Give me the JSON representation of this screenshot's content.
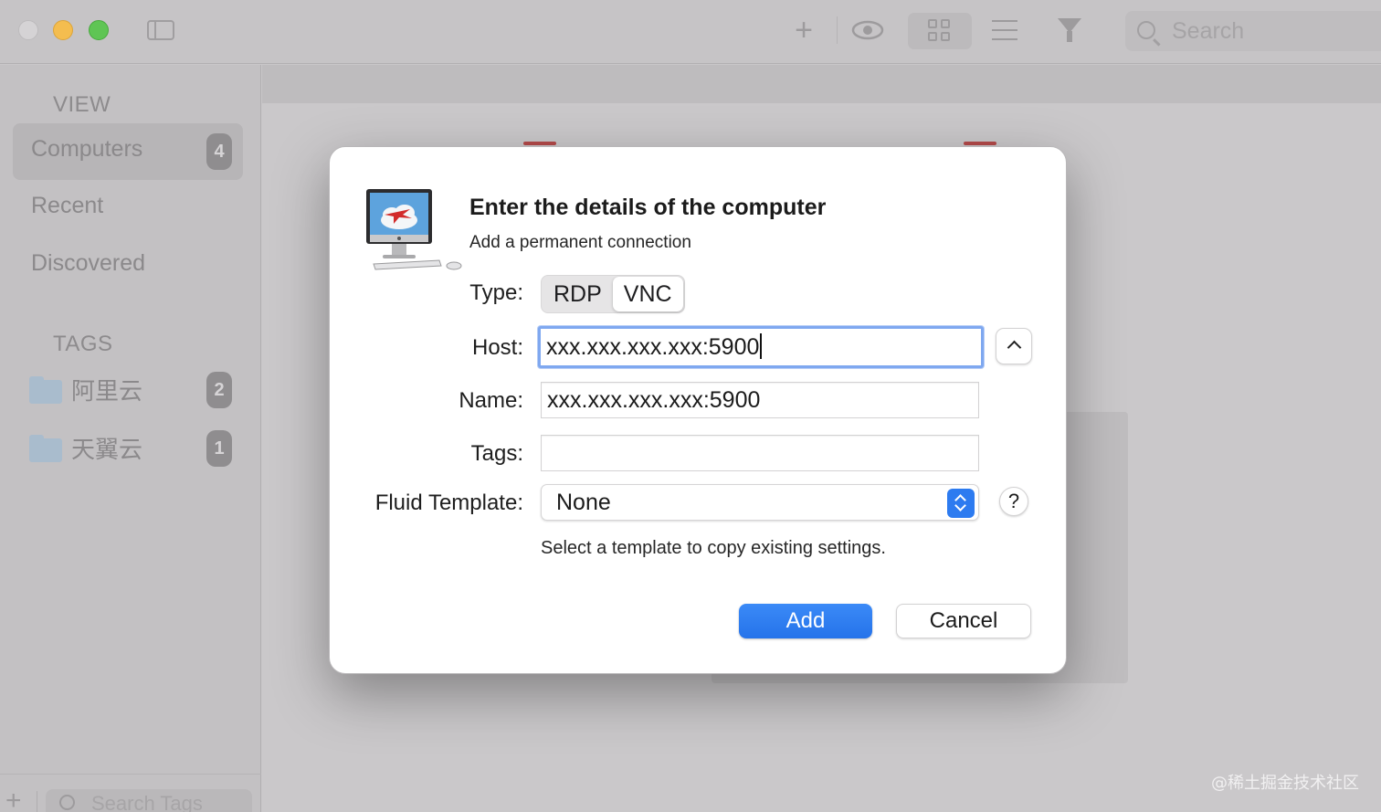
{
  "toolbar": {
    "search_placeholder": "Search"
  },
  "sidebar": {
    "view_title": "VIEW",
    "items": [
      {
        "label": "Computers",
        "badge": "4"
      },
      {
        "label": "Recent"
      },
      {
        "label": "Discovered"
      }
    ],
    "tags_title": "TAGS",
    "tags": [
      {
        "label": "阿里云",
        "badge": "2"
      },
      {
        "label": "天翼云",
        "badge": "1"
      }
    ],
    "search_tags_placeholder": "Search Tags"
  },
  "dialog": {
    "title": "Enter the details of the computer",
    "subtitle": "Add a permanent connection",
    "type_label": "Type:",
    "type_options": [
      "RDP",
      "VNC"
    ],
    "type_selected": "VNC",
    "host_label": "Host:",
    "host_value": "xxx.xxx.xxx.xxx:5900",
    "name_label": "Name:",
    "name_value": "xxx.xxx.xxx.xxx:5900",
    "tags_label": "Tags:",
    "tags_value": "",
    "template_label": "Fluid Template:",
    "template_value": "None",
    "help_label": "?",
    "hint": "Select a template to copy existing settings.",
    "add_label": "Add",
    "cancel_label": "Cancel"
  },
  "watermark": "@稀土掘金技术社区",
  "colors": {
    "accent": "#2d7bf0",
    "focus_ring": "#7fa8f0"
  }
}
